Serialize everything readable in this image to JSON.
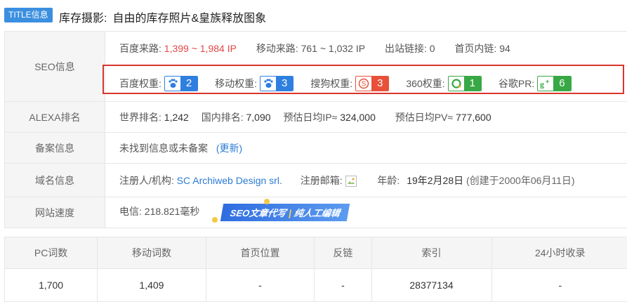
{
  "header": {
    "badge": "TITLE信息",
    "label": "库存摄影:",
    "title": "自由的库存照片&皇族释放图象"
  },
  "seo": {
    "label": "SEO信息",
    "baidu_source_label": "百度来路:",
    "baidu_source_value": "1,399 ~ 1,984",
    "baidu_source_unit": "IP",
    "mobile_source_label": "移动来路:",
    "mobile_source_value": "761 ~ 1,032 IP",
    "outlinks_label": "出站链接:",
    "outlinks_value": "0",
    "inlinks_label": "首页内链:",
    "inlinks_value": "94",
    "weights": [
      {
        "label": "百度权重:",
        "value": "2",
        "color": "#2f7fe0",
        "icon": "baidu-paw-icon"
      },
      {
        "label": "移动权重:",
        "value": "3",
        "color": "#2f7fe0",
        "icon": "mobile-paw-icon"
      },
      {
        "label": "搜狗权重:",
        "value": "3",
        "color": "#e8503a",
        "icon": "sogou-icon"
      },
      {
        "label": "360权重:",
        "value": "1",
        "color": "#37a845",
        "icon": "360-icon"
      },
      {
        "label": "谷歌PR:",
        "value": "6",
        "color": "#37a845",
        "icon": "google-plus-icon"
      }
    ]
  },
  "alexa": {
    "label": "ALEXA排名",
    "world_label": "世界排名:",
    "world_value": "1,242",
    "domestic_label": "国内排名:",
    "domestic_value": "7,090",
    "ip_label": "预估日均IP≈",
    "ip_value": "324,000",
    "pv_label": "预估日均PV≈",
    "pv_value": "777,600"
  },
  "icp": {
    "label": "备案信息",
    "text": "未找到信息或未备案",
    "update_link": "(更新)"
  },
  "domain": {
    "label": "域名信息",
    "registrant_label": "注册人/机构:",
    "registrant_value": "SC Archiweb Design srl.",
    "email_label": "注册邮箱:",
    "age_label": "年龄:",
    "age_value": "19年2月28日",
    "created_value": "(创建于2000年06月11日)"
  },
  "speed": {
    "label": "网站速度",
    "telecom": "电信: 218.821毫秒",
    "banner_left": "SEO文章代写",
    "banner_right": "纯人工编辑"
  },
  "stats": {
    "headers": [
      "PC词数",
      "移动词数",
      "首页位置",
      "反链",
      "索引",
      "24小时收录"
    ],
    "values": [
      "1,700",
      "1,409",
      "-",
      "-",
      "28377134",
      "-"
    ]
  }
}
